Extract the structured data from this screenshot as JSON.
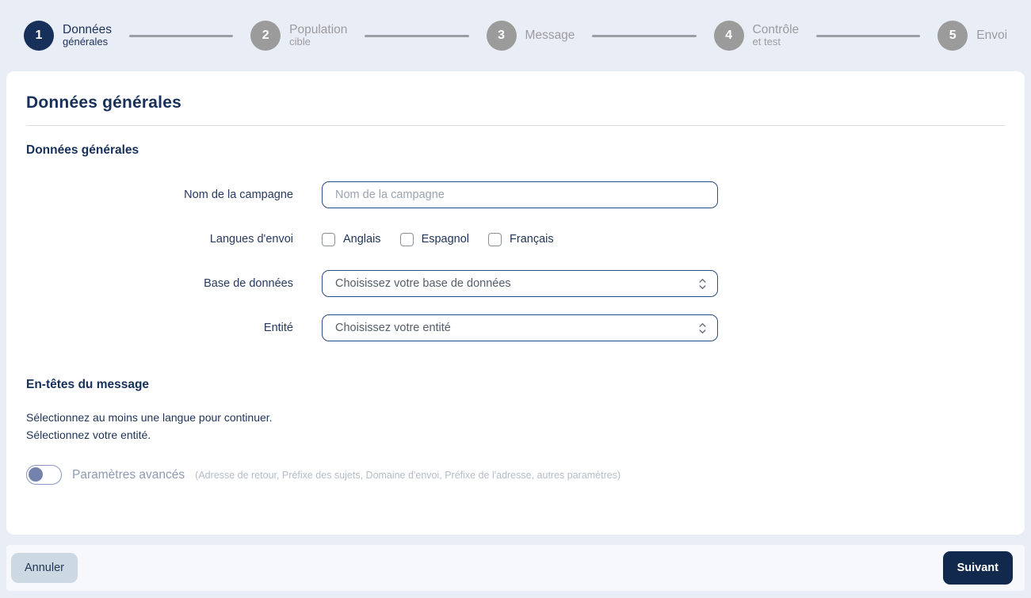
{
  "theme": {
    "page_background": "#e9edf5",
    "card_background": "#ffffff",
    "primary_navy": "#16305a",
    "inactive_gray": "#9b9b9b",
    "input_border_blue": "#2d4b85",
    "footer_background": "#f6f8fc",
    "cancel_button_bg": "#cdd9e2",
    "next_button_bg": "#12294e"
  },
  "stepper": {
    "steps": [
      {
        "number": "1",
        "line1": "Données",
        "line2": "générales",
        "state": "active"
      },
      {
        "number": "2",
        "line1": "Population",
        "line2": "cible",
        "state": "inactive"
      },
      {
        "number": "3",
        "line1": "Message",
        "line2": "",
        "state": "inactive"
      },
      {
        "number": "4",
        "line1": "Contrôle",
        "line2": "et test",
        "state": "inactive"
      },
      {
        "number": "5",
        "line1": "Envoi",
        "line2": "",
        "state": "inactive"
      }
    ]
  },
  "page": {
    "title": "Données générales"
  },
  "general_section": {
    "heading": "Données générales",
    "campaign_name": {
      "label": "Nom de la campagne",
      "placeholder": "Nom de la campagne",
      "value": ""
    },
    "languages": {
      "label": "Langues d'envoi",
      "options": [
        {
          "label": "Anglais",
          "checked": false
        },
        {
          "label": "Espagnol",
          "checked": false
        },
        {
          "label": "Français",
          "checked": false
        }
      ]
    },
    "database": {
      "label": "Base de données",
      "selected": "Choisissez votre base de données"
    },
    "entity": {
      "label": "Entité",
      "selected": "Choisissez votre entité"
    }
  },
  "headers_section": {
    "heading": "En-têtes du message",
    "messages": [
      "Sélectionnez au moins une langue pour continuer.",
      "Sélectionnez votre entité."
    ],
    "advanced": {
      "label": "Paramètres avancés",
      "hint": "(Adresse de retour, Préfixe des sujets, Domaine d'envoi, Préfixe de l'adresse, autres paramètres)",
      "enabled": false
    }
  },
  "footer": {
    "cancel_label": "Annuler",
    "next_label": "Suivant"
  }
}
